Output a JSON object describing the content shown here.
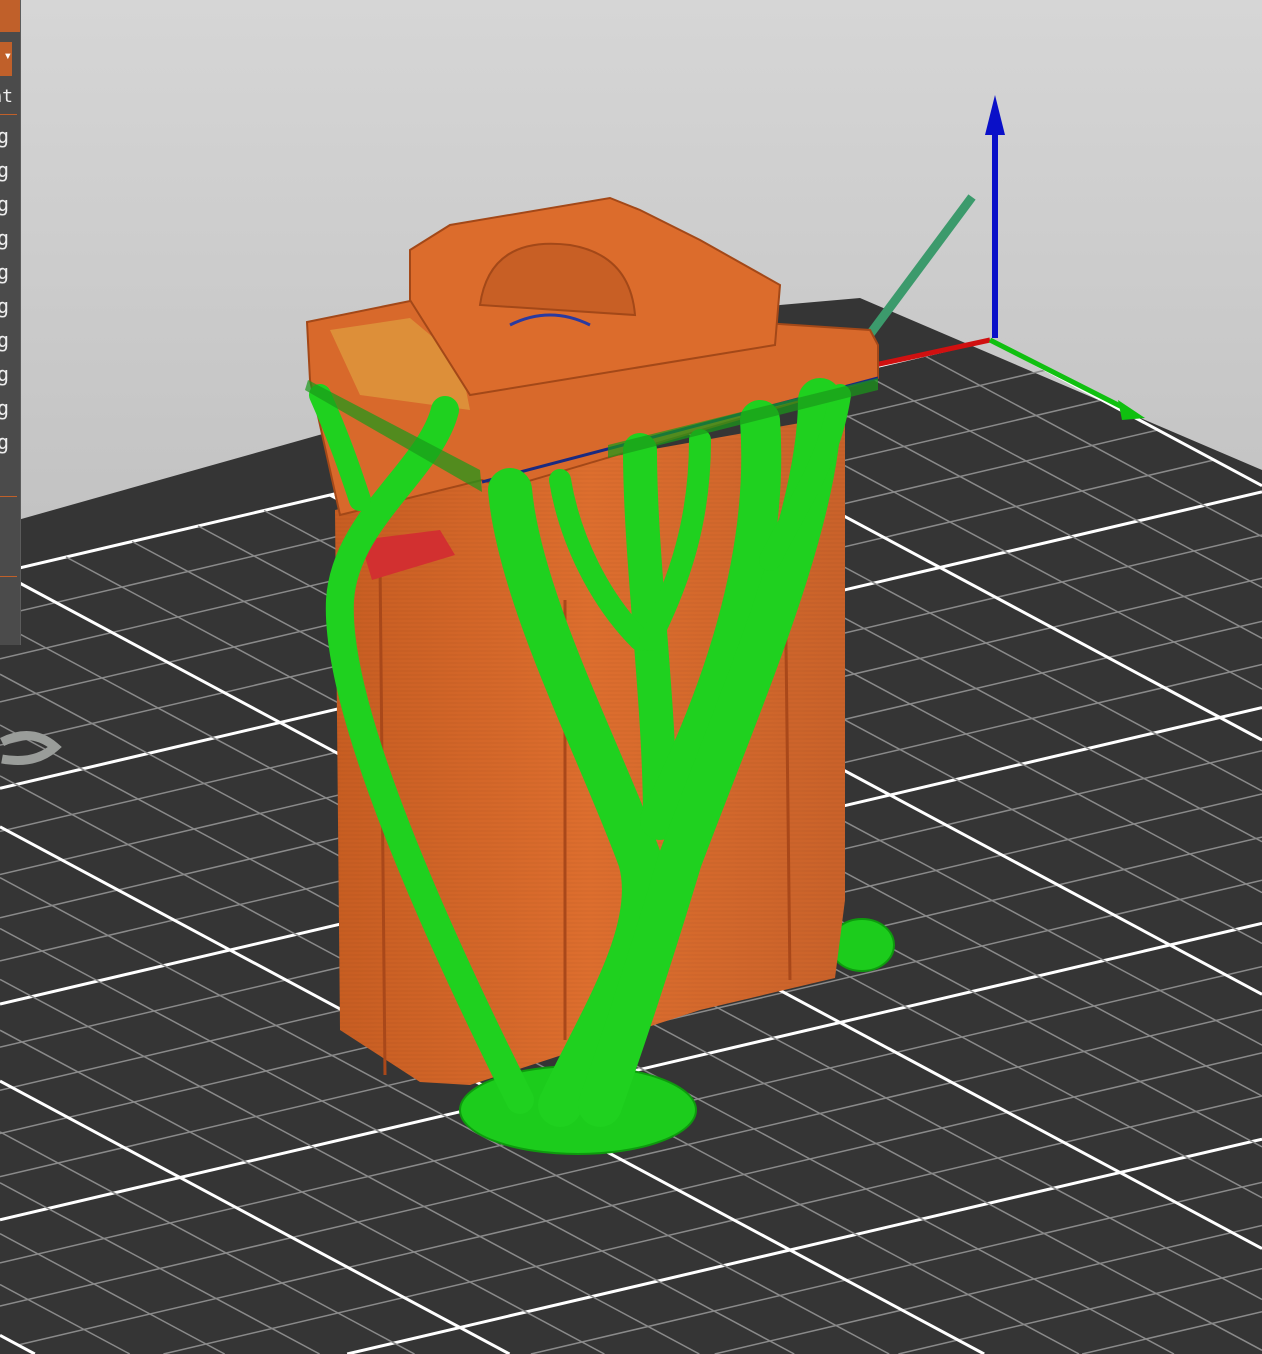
{
  "viewport": {
    "bed_color": "#333333",
    "grid_minor_color": "#8a8a8a",
    "grid_major_color": "#ffffff",
    "model_color": "#d9692a",
    "support_color": "#1fd11f",
    "axis_colors": {
      "x": "#d01010",
      "y": "#10c010",
      "z": "#0a10c8"
    }
  },
  "legend": {
    "dropdown_icon": "chevron-down-icon",
    "column_header": "nt",
    "rows": [
      "g",
      "g",
      "g",
      "g",
      "g",
      "g",
      "g",
      "g",
      "g",
      "g"
    ]
  }
}
